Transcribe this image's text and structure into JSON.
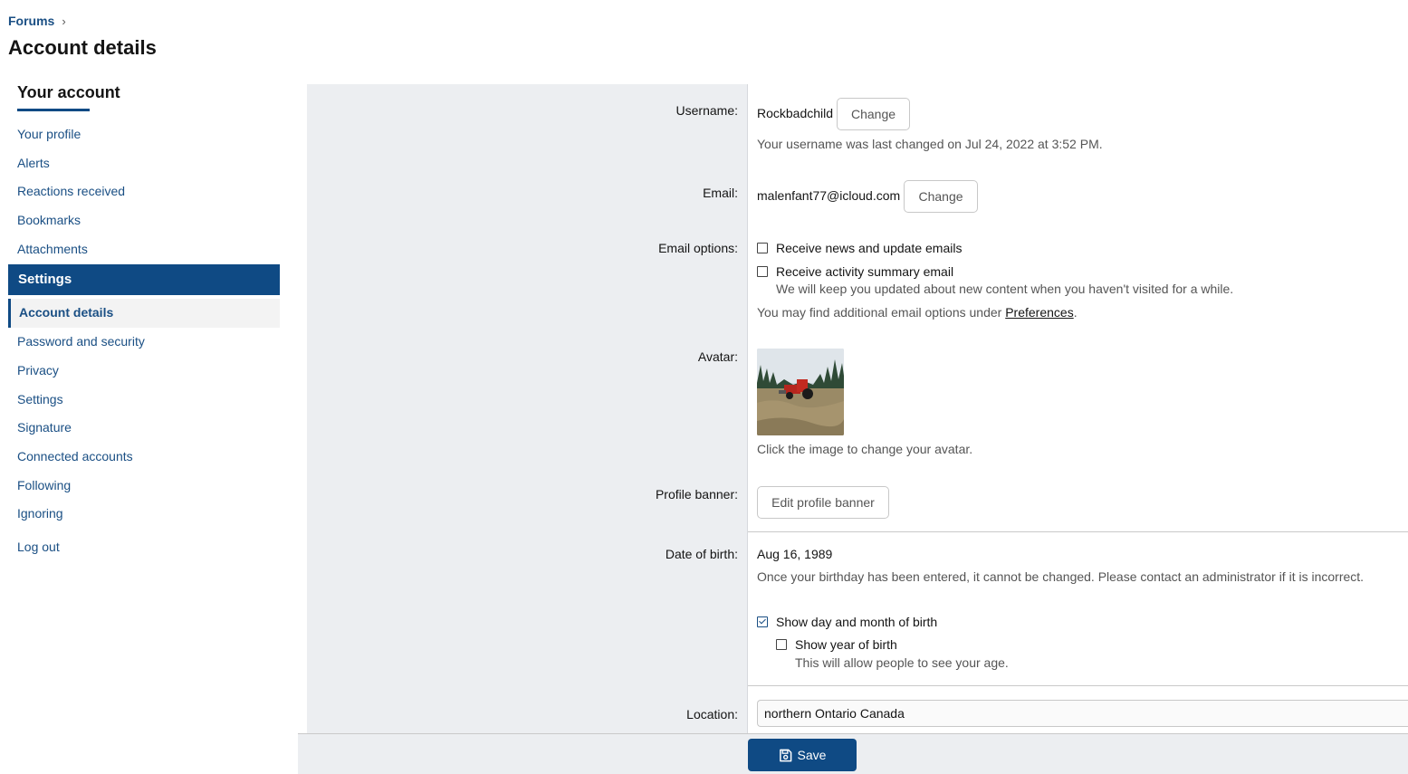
{
  "breadcrumb": {
    "forums": "Forums"
  },
  "page_title": "Account details",
  "sidebar": {
    "header": "Your account",
    "items_top": [
      "Your profile",
      "Alerts",
      "Reactions received",
      "Bookmarks",
      "Attachments"
    ],
    "section": "Settings",
    "active": "Account details",
    "items_settings": [
      "Password and security",
      "Privacy",
      "Settings",
      "Signature",
      "Connected accounts",
      "Following",
      "Ignoring"
    ],
    "logout": "Log out"
  },
  "form": {
    "username": {
      "label": "Username:",
      "value": "Rockbadchild",
      "button": "Change",
      "hint": "Your username was last changed on Jul 24, 2022 at 3:52 PM."
    },
    "email": {
      "label": "Email:",
      "value": "malenfant77@icloud.com",
      "button": "Change"
    },
    "email_options": {
      "label": "Email options:",
      "news": "Receive news and update emails",
      "summary": "Receive activity summary email",
      "summary_hint": "We will keep you updated about new content when you haven't visited for a while.",
      "prefs_text": "You may find additional email options under ",
      "prefs_link": "Preferences",
      "prefs_end": "."
    },
    "avatar": {
      "label": "Avatar:",
      "hint": "Click the image to change your avatar."
    },
    "banner": {
      "label": "Profile banner:",
      "button": "Edit profile banner"
    },
    "dob": {
      "label": "Date of birth:",
      "value": "Aug 16, 1989",
      "hint": "Once your birthday has been entered, it cannot be changed. Please contact an administrator if it is incorrect.",
      "show_day_month": "Show day and month of birth",
      "show_year": "Show year of birth",
      "show_year_hint": "This will allow people to see your age."
    },
    "location": {
      "label": "Location:",
      "value": "northern Ontario Canada"
    }
  },
  "save_label": "Save",
  "colors": {
    "primary": "#0f4a84",
    "link": "#1a4f84",
    "label_bg": "#eceef1"
  }
}
